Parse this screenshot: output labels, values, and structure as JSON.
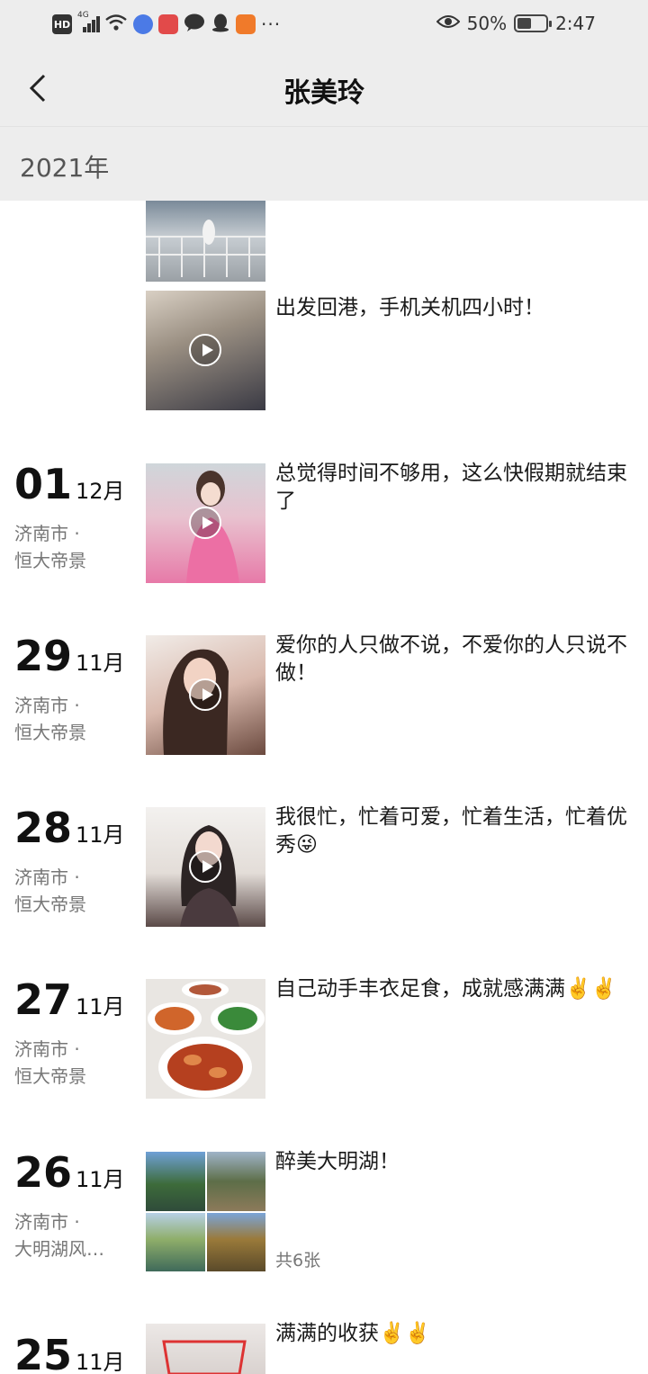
{
  "statusbar": {
    "hd": "HD",
    "net": "4G",
    "battery_pct": "50%",
    "battery_level": 0.5,
    "time": "2:47",
    "more": "···",
    "icons": [
      "eye-icon",
      "wifi-icon",
      "signal-icon",
      "music-icon",
      "chat-icon",
      "qq-icon",
      "apps-icon"
    ]
  },
  "nav": {
    "title": "张美玲"
  },
  "year": "2021年",
  "posts": [
    {
      "day": "",
      "month": "",
      "city": "",
      "place": "",
      "text": "出发回港，手机关机四小时！",
      "type": "video"
    },
    {
      "day": "01",
      "month": "12月",
      "city": "济南市 ·",
      "place": "恒大帝景",
      "text": "总觉得时间不够用，这么快假期就结束了",
      "type": "video"
    },
    {
      "day": "29",
      "month": "11月",
      "city": "济南市 ·",
      "place": "恒大帝景",
      "text": "爱你的人只做不说，不爱你的人只说不做！",
      "type": "video"
    },
    {
      "day": "28",
      "month": "11月",
      "city": "济南市 ·",
      "place": "恒大帝景",
      "text": "我很忙，忙着可爱，忙着生活，忙着优秀😜",
      "type": "video"
    },
    {
      "day": "27",
      "month": "11月",
      "city": "济南市 ·",
      "place": "恒大帝景",
      "text": "自己动手丰衣足食，成就感满满✌️✌️",
      "type": "photo"
    },
    {
      "day": "26",
      "month": "11月",
      "city": "济南市 ·",
      "place": "大明湖风…",
      "text": "醉美大明湖！",
      "count": "共6张",
      "type": "gallery"
    },
    {
      "day": "25",
      "month": "11月",
      "city": "",
      "place": "",
      "text": "满满的收获✌️✌️",
      "type": "photo"
    }
  ],
  "colors": {
    "header_bg": "#ededed",
    "text": "#1a1a1a",
    "muted": "#777777"
  }
}
